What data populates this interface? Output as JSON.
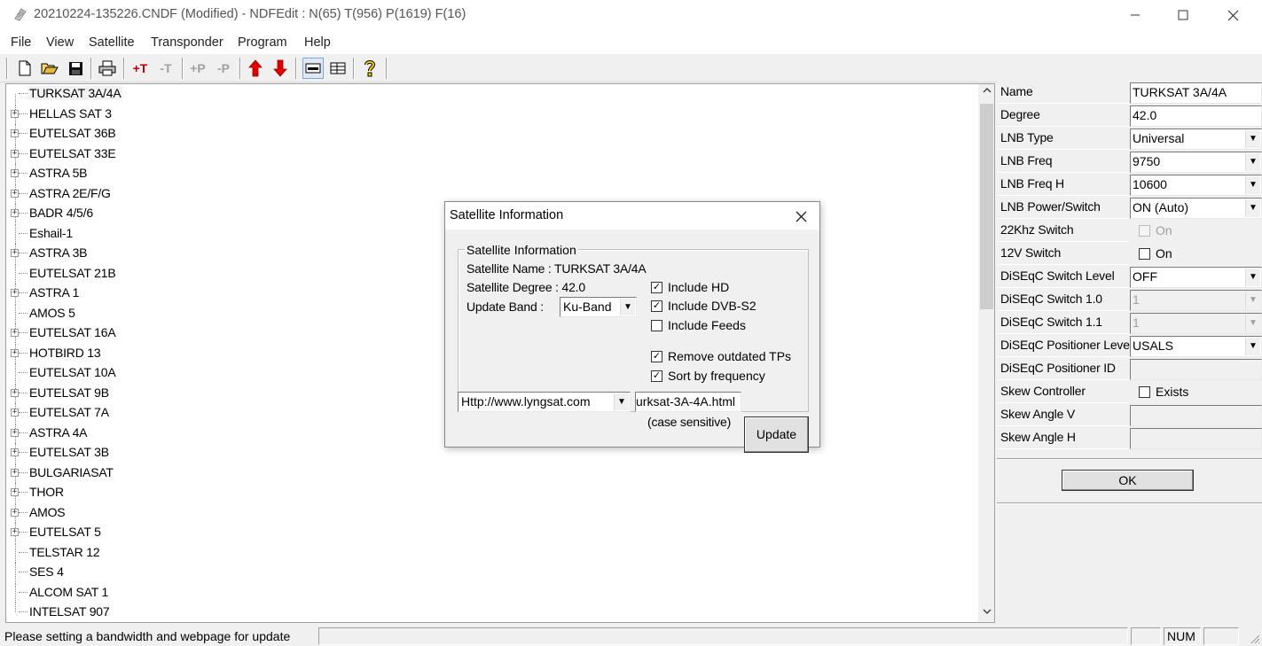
{
  "window": {
    "title": "20210224-135226.CNDF (Modified) - NDFEdit : N(65) T(956) P(1619) F(16)",
    "minimize": "—",
    "maximize": "☐",
    "close": "✕"
  },
  "menu": [
    "File",
    "View",
    "Satellite",
    "Transponder",
    "Program",
    "Help"
  ],
  "toolbar": {
    "new_icon": "new-file-icon",
    "open_icon": "open-folder-icon",
    "save_icon": "save-icon",
    "print_icon": "print-icon",
    "add_transponder": "+T",
    "remove_transponder": "-T",
    "add_program": "+P",
    "remove_program": "-P",
    "move_up": "↑",
    "move_down": "↓",
    "help": "?",
    "colors": {
      "arrow": "#e00000",
      "active_bg": "#dfe8f5"
    }
  },
  "tree": {
    "items": [
      {
        "label": "TURKSAT 3A/4A",
        "expandable": false,
        "selected": true
      },
      {
        "label": "HELLAS SAT 3",
        "expandable": true
      },
      {
        "label": "EUTELSAT 36B",
        "expandable": true
      },
      {
        "label": "EUTELSAT 33E",
        "expandable": true
      },
      {
        "label": "ASTRA 5B",
        "expandable": true
      },
      {
        "label": "ASTRA 2E/F/G",
        "expandable": true
      },
      {
        "label": "BADR 4/5/6",
        "expandable": true
      },
      {
        "label": "Eshail-1",
        "expandable": false
      },
      {
        "label": "ASTRA 3B",
        "expandable": true
      },
      {
        "label": "EUTELSAT 21B",
        "expandable": false
      },
      {
        "label": "ASTRA 1",
        "expandable": true
      },
      {
        "label": "AMOS 5",
        "expandable": false
      },
      {
        "label": "EUTELSAT 16A",
        "expandable": true
      },
      {
        "label": "HOTBIRD 13",
        "expandable": true
      },
      {
        "label": "EUTELSAT 10A",
        "expandable": false
      },
      {
        "label": "EUTELSAT 9B",
        "expandable": true
      },
      {
        "label": "EUTELSAT 7A",
        "expandable": true
      },
      {
        "label": "ASTRA 4A",
        "expandable": true
      },
      {
        "label": "EUTELSAT 3B",
        "expandable": true
      },
      {
        "label": "BULGARIASAT",
        "expandable": true
      },
      {
        "label": "THOR",
        "expandable": true
      },
      {
        "label": "AMOS",
        "expandable": true
      },
      {
        "label": "EUTELSAT 5",
        "expandable": true
      },
      {
        "label": "TELSTAR 12",
        "expandable": false
      },
      {
        "label": "SES 4",
        "expandable": false
      },
      {
        "label": "ALCOM SAT 1",
        "expandable": false
      },
      {
        "label": "INTELSAT 907",
        "expandable": false
      }
    ]
  },
  "properties": {
    "rows": [
      {
        "label": "Name",
        "type": "input",
        "value": "TURKSAT 3A/4A"
      },
      {
        "label": "Degree",
        "type": "input",
        "value": "42.0"
      },
      {
        "label": "LNB Type",
        "type": "select",
        "value": "Universal"
      },
      {
        "label": "LNB Freq",
        "type": "select",
        "value": "9750"
      },
      {
        "label": "LNB Freq H",
        "type": "select",
        "value": "10600"
      },
      {
        "label": "LNB Power/Switch",
        "type": "select",
        "value": "ON (Auto)"
      },
      {
        "label": "22Khz Switch",
        "type": "check",
        "value": "On",
        "checked": false,
        "disabled": true
      },
      {
        "label": "12V Switch",
        "type": "check",
        "value": "On",
        "checked": false,
        "disabled": false
      },
      {
        "label": "DiSEqC Switch Level",
        "type": "select",
        "value": "OFF"
      },
      {
        "label": "DiSEqC Switch 1.0",
        "type": "select",
        "value": "1",
        "disabled": true
      },
      {
        "label": "DiSEqC Switch 1.1",
        "type": "select",
        "value": "1",
        "disabled": true
      },
      {
        "label": "DiSEqC Positioner Level",
        "type": "select",
        "value": "USALS"
      },
      {
        "label": "DiSEqC Positioner ID",
        "type": "input",
        "value": "",
        "disabled": true
      },
      {
        "label": "Skew Controller",
        "type": "check",
        "value": "Exists",
        "checked": false,
        "disabled": false
      },
      {
        "label": "Skew Angle V",
        "type": "input",
        "value": "",
        "disabled": true
      },
      {
        "label": "Skew Angle H",
        "type": "input",
        "value": "",
        "disabled": true
      }
    ],
    "ok_label": "OK"
  },
  "status": {
    "message": "Please setting a bandwidth and webpage for update",
    "num": "NUM"
  },
  "dialog": {
    "title": "Satellite Information",
    "group_title": "Satellite Information",
    "sat_name_line": "Satellite Name : TURKSAT 3A/4A",
    "sat_degree_line": "Satellite Degree : 42.0",
    "update_band_label": "Update Band :",
    "update_band_value": "Ku-Band",
    "include_hd": "Include HD",
    "include_dvbs2": "Include DVB-S2",
    "include_feeds": "Include Feeds",
    "remove_outdated": "Remove outdated TPs",
    "sort_by_freq": "Sort by frequency",
    "checks": {
      "include_hd": true,
      "include_dvbs2": true,
      "include_feeds": false,
      "remove_outdated": true,
      "sort_by_freq": true
    },
    "source_url": "Http://www.lyngsat.com",
    "page_name": "urksat-3A-4A.html",
    "case_note": "(case sensitive)",
    "update_label": "Update",
    "close": "✕"
  }
}
